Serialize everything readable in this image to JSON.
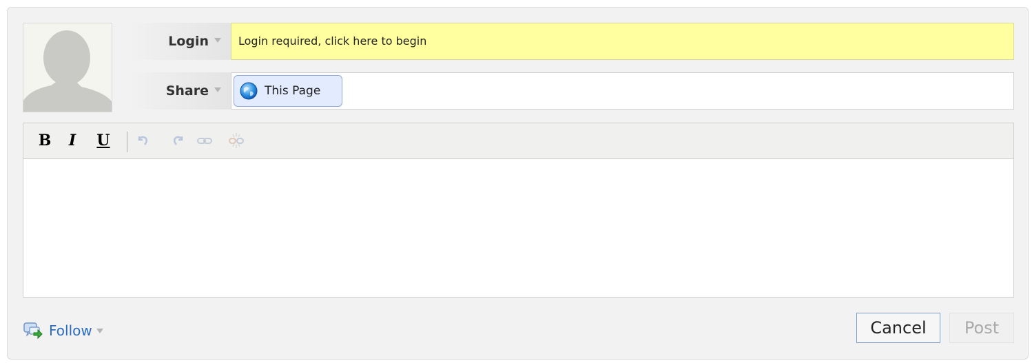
{
  "login": {
    "label": "Login",
    "prompt": "Login required, click here to begin"
  },
  "share": {
    "label": "Share",
    "chip_label": "This Page",
    "chip_icon": "globe-icon"
  },
  "editor": {
    "toolbar": {
      "bold": "B",
      "italic": "I",
      "underline": "U",
      "disabled_tools": [
        "undo-icon",
        "redo-icon",
        "link-icon",
        "unlink-icon"
      ]
    },
    "text": ""
  },
  "footer": {
    "follow_label": "Follow",
    "follow_icon": "follow-icon",
    "cancel_label": "Cancel",
    "post_label": "Post"
  },
  "colors": {
    "login_bg": "#ffffa0",
    "link": "#2a6cc2",
    "chip_bg": "#e3ebff"
  }
}
